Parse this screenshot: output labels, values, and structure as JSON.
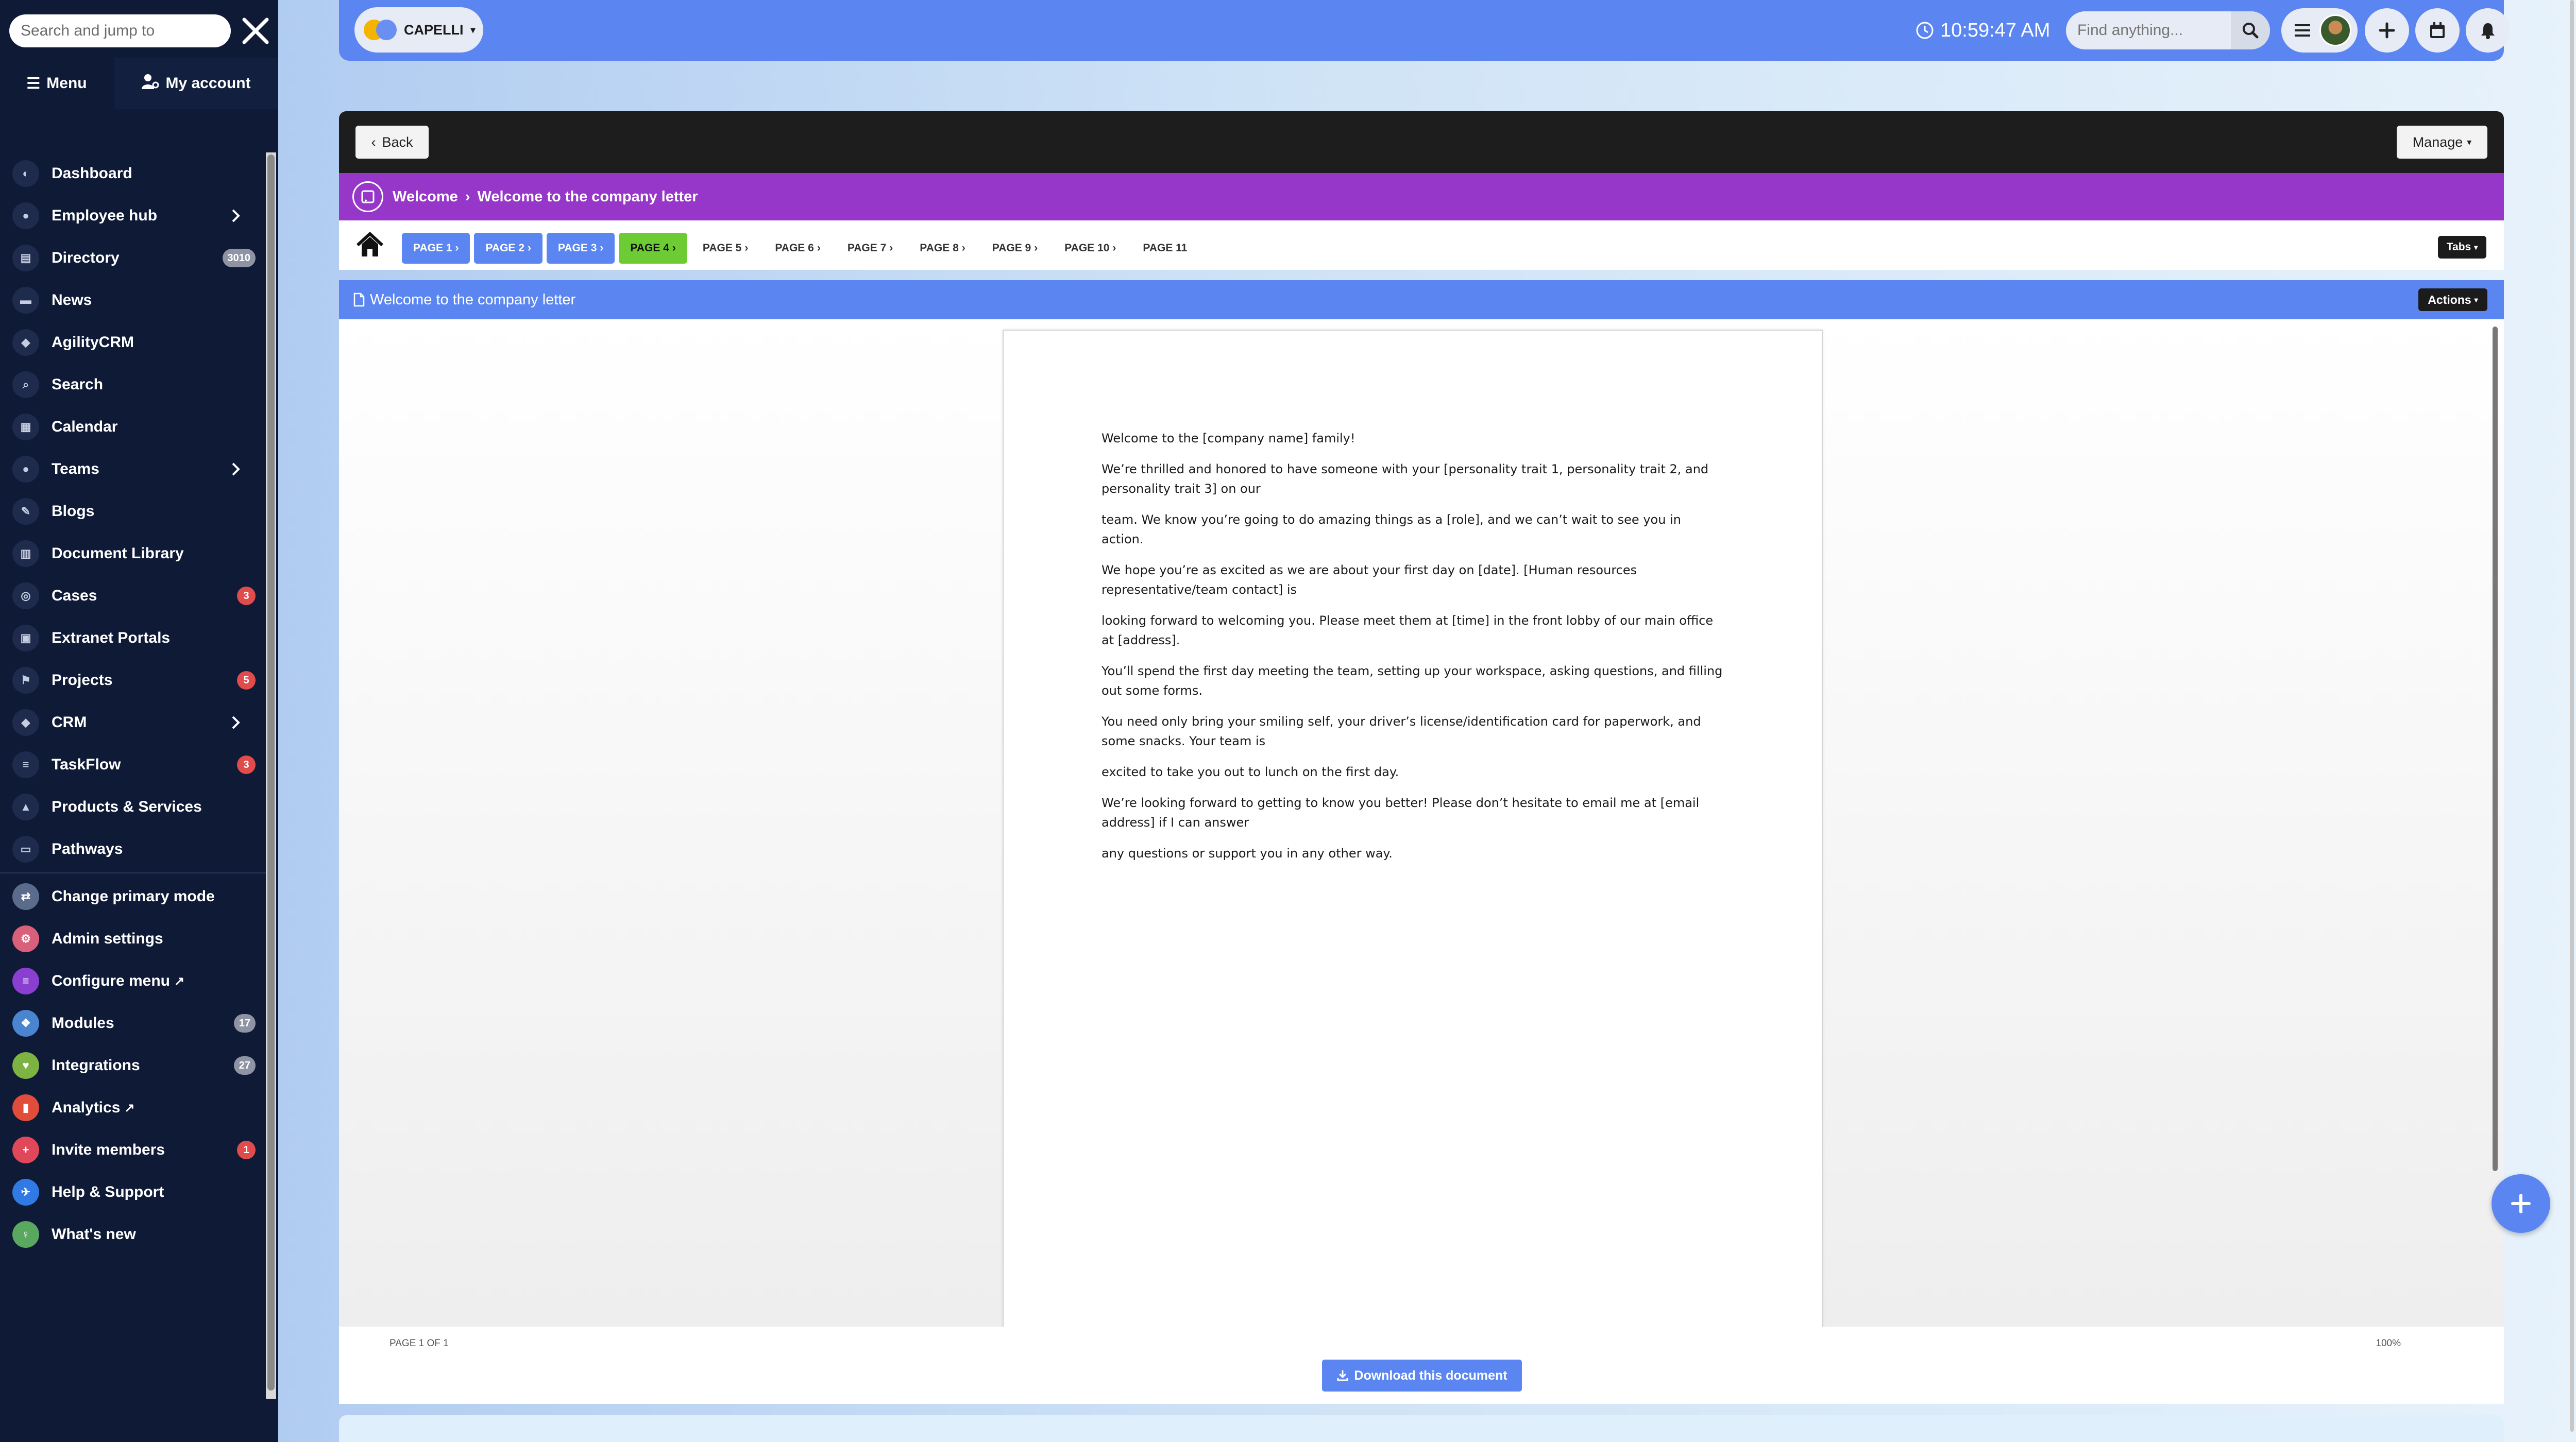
{
  "sidebar": {
    "search_placeholder": "Search and jump to",
    "menu_label": "Menu",
    "account_label": "My account",
    "items": [
      {
        "label": "Dashboard",
        "icon": "dashboard-icon"
      },
      {
        "label": "Employee hub",
        "icon": "people-icon",
        "chevron": true
      },
      {
        "label": "Directory",
        "icon": "directory-icon",
        "badge": "3010",
        "badge_color": "gray"
      },
      {
        "label": "News",
        "icon": "news-icon"
      },
      {
        "label": "AgilityCRM",
        "icon": "crm-icon"
      },
      {
        "label": "Search",
        "icon": "search-icon"
      },
      {
        "label": "Calendar",
        "icon": "calendar-icon"
      },
      {
        "label": "Teams",
        "icon": "teams-icon",
        "chevron": true
      },
      {
        "label": "Blogs",
        "icon": "blog-icon"
      },
      {
        "label": "Document Library",
        "icon": "library-icon"
      },
      {
        "label": "Cases",
        "icon": "cases-icon",
        "badge": "3",
        "badge_color": "red"
      },
      {
        "label": "Extranet Portals",
        "icon": "portal-icon"
      },
      {
        "label": "Projects",
        "icon": "projects-icon",
        "badge": "5",
        "badge_color": "red"
      },
      {
        "label": "CRM",
        "icon": "crm-icon",
        "chevron": true
      },
      {
        "label": "TaskFlow",
        "icon": "taskflow-icon",
        "badge": "3",
        "badge_color": "red"
      },
      {
        "label": "Products & Services",
        "icon": "products-icon"
      },
      {
        "label": "Pathways",
        "icon": "pathways-icon"
      }
    ],
    "admin_items": [
      {
        "label": "Change primary mode",
        "icon": "swap-icon",
        "color": "#5a6b8c"
      },
      {
        "label": "Admin settings",
        "icon": "settings-icon",
        "color": "#d9607a"
      },
      {
        "label": "Configure menu",
        "icon": "menu-icon",
        "color": "#8a3fd1",
        "ext": true
      },
      {
        "label": "Modules",
        "icon": "modules-icon",
        "color": "#4a86d0",
        "badge": "17",
        "badge_color": "gray"
      },
      {
        "label": "Integrations",
        "icon": "integrations-icon",
        "color": "#7cb342",
        "badge": "27",
        "badge_color": "gray"
      },
      {
        "label": "Analytics",
        "icon": "analytics-icon",
        "color": "#e24c3b",
        "ext": true
      },
      {
        "label": "Invite members",
        "icon": "invite-icon",
        "color": "#e0485a",
        "badge": "1",
        "badge_color": "red"
      },
      {
        "label": "Help & Support",
        "icon": "help-icon",
        "color": "#2f7ae5"
      },
      {
        "label": "What's new",
        "icon": "whats-new-icon",
        "color": "#5aa860"
      }
    ]
  },
  "topbar": {
    "brand": "CAPELLI",
    "time": "10:59:47 AM",
    "find_placeholder": "Find anything..."
  },
  "toolbar": {
    "back_label": "Back",
    "manage_label": "Manage"
  },
  "breadcrumb": {
    "parent": "Welcome",
    "current": "Welcome to the company letter"
  },
  "pages": {
    "tabs": [
      {
        "label": "PAGE 1",
        "state": "visited"
      },
      {
        "label": "PAGE 2",
        "state": "visited"
      },
      {
        "label": "PAGE 3",
        "state": "visited"
      },
      {
        "label": "PAGE 4",
        "state": "active"
      },
      {
        "label": "PAGE 5",
        "state": "normal"
      },
      {
        "label": "PAGE 6",
        "state": "normal"
      },
      {
        "label": "PAGE 7",
        "state": "normal"
      },
      {
        "label": "PAGE 8",
        "state": "normal"
      },
      {
        "label": "PAGE 9",
        "state": "normal"
      },
      {
        "label": "PAGE 10",
        "state": "normal"
      },
      {
        "label": "PAGE 11",
        "state": "last"
      }
    ],
    "tabs_button": "Tabs"
  },
  "document": {
    "title": "Welcome to the company letter",
    "actions_label": "Actions",
    "paragraphs": [
      "Welcome to the [company name] family!",
      "We’re thrilled and honored to have someone with your [personality trait 1, personality trait 2, and personality trait 3] on our",
      "team. We know you’re going to do amazing things as a [role], and we can’t wait to see you in action.",
      "We hope you’re as excited as we are about your first day on [date]. [Human resources representative/team contact] is",
      "looking forward to welcoming you. Please meet them at [time] in the front lobby of our main office at [address].",
      "You’ll spend the first day meeting the team, setting up your workspace, asking questions, and filling out some forms.",
      "You need only bring your smiling self, your driver’s license/identification card for paperwork, and some snacks. Your team is",
      "excited to take you out to lunch on the first day.",
      "We’re looking forward to getting to know you better! Please don’t hesitate to email me at [email address] if I can answer",
      "any questions or support you in any other way."
    ],
    "page_count": "PAGE 1 OF 1",
    "zoom": "100%",
    "download_label": "Download this document"
  },
  "colors": {
    "accent": "#5b86f2",
    "purple": "#9637c9",
    "active_tab": "#6dcc33",
    "sidebar_bg": "#0f1a36"
  }
}
